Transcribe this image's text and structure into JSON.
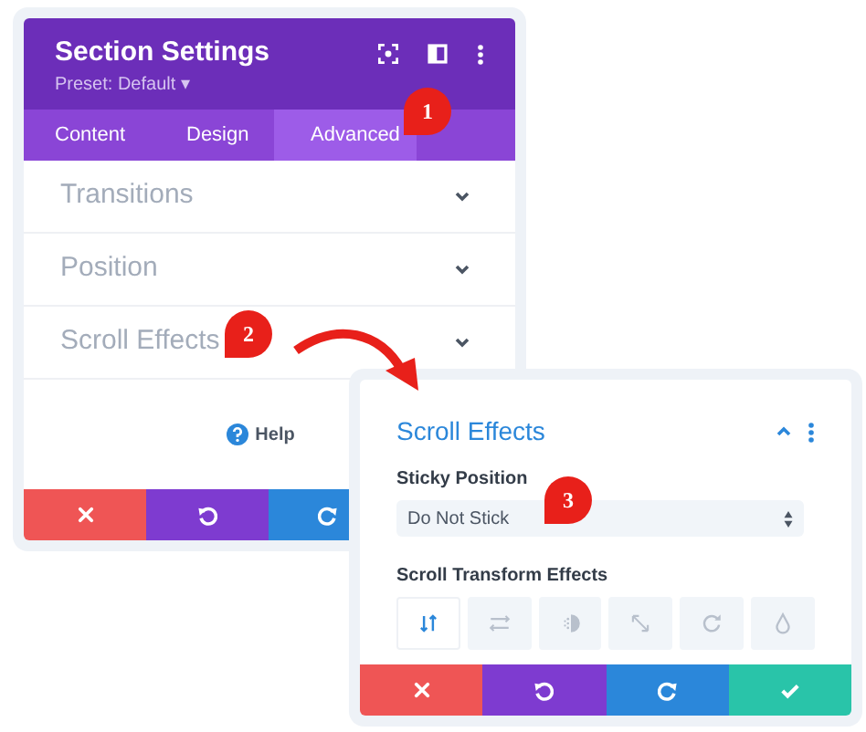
{
  "settings_panel": {
    "title": "Section Settings",
    "preset": "Preset: Default ▾",
    "tabs": [
      {
        "label": "Content",
        "selected": false
      },
      {
        "label": "Design",
        "selected": false
      },
      {
        "label": "Advanced",
        "selected": true
      }
    ],
    "sections": [
      {
        "title": "Transitions",
        "expanded": false
      },
      {
        "title": "Position",
        "expanded": false
      },
      {
        "title": "Scroll Effects",
        "expanded": false
      }
    ],
    "help": "Help"
  },
  "scroll_effects_panel": {
    "title": "Scroll Effects",
    "expanded": true,
    "sticky_position": {
      "label": "Sticky Position",
      "value": "Do Not Stick"
    },
    "transform_effects": {
      "label": "Scroll Transform Effects",
      "options": [
        {
          "selected": true
        },
        {
          "selected": false
        },
        {
          "selected": false
        },
        {
          "selected": false
        },
        {
          "selected": false
        },
        {
          "selected": false
        }
      ]
    }
  },
  "callouts": [
    "1",
    "2",
    "3"
  ]
}
